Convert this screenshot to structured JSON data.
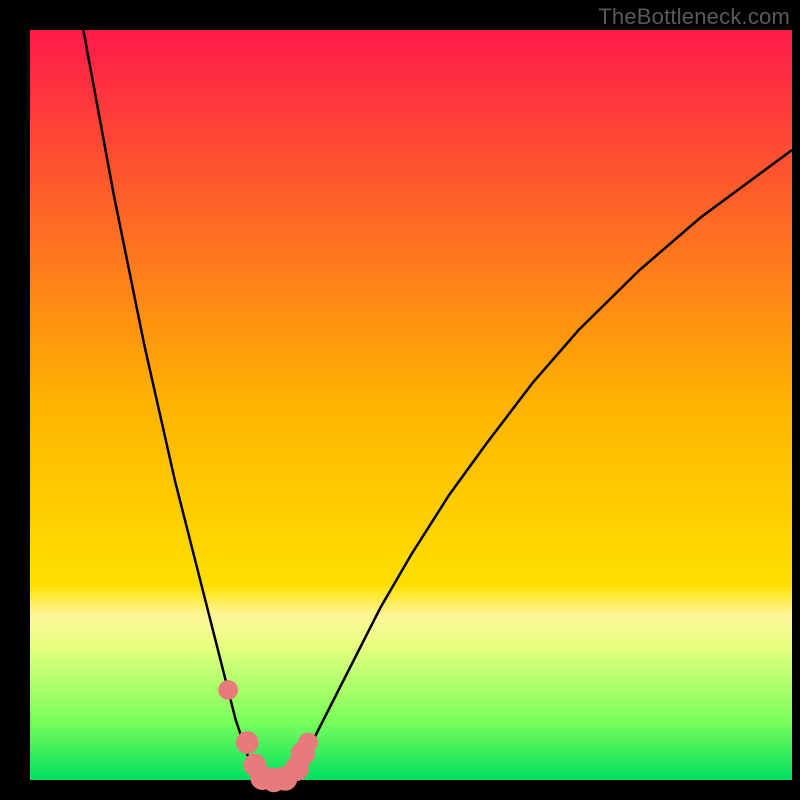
{
  "watermark": "TheBottleneck.com",
  "chart_data": {
    "type": "line",
    "title": "",
    "xlabel": "",
    "ylabel": "",
    "xlim": [
      0,
      100
    ],
    "ylim": [
      0,
      100
    ],
    "background_gradient": {
      "stops": [
        {
          "offset": 0,
          "color": "#ff1a4a"
        },
        {
          "offset": 50,
          "color": "#ffb400"
        },
        {
          "offset": 74,
          "color": "#ffe000"
        },
        {
          "offset": 78,
          "color": "#fff79a"
        },
        {
          "offset": 82,
          "color": "#e8ff80"
        },
        {
          "offset": 92,
          "color": "#7cff5a"
        },
        {
          "offset": 100,
          "color": "#00e060"
        }
      ]
    },
    "series": [
      {
        "name": "left-curve",
        "x": [
          7,
          9,
          11,
          13,
          15,
          17,
          19,
          21,
          23,
          25,
          26,
          27,
          28,
          29,
          30
        ],
        "y": [
          100,
          89,
          78,
          68,
          58,
          49,
          40,
          32,
          24,
          16,
          12,
          8,
          5,
          2,
          0
        ]
      },
      {
        "name": "right-curve",
        "x": [
          34,
          36,
          38,
          40,
          43,
          46,
          50,
          55,
          60,
          66,
          72,
          80,
          88,
          96,
          100
        ],
        "y": [
          0,
          3,
          7,
          11,
          17,
          23,
          30,
          38,
          45,
          53,
          60,
          68,
          75,
          81,
          84
        ]
      },
      {
        "name": "flat-bottom",
        "x": [
          30,
          34
        ],
        "y": [
          0,
          0
        ]
      }
    ],
    "markers": [
      {
        "x": 26.0,
        "y": 12.0,
        "r": 1.3
      },
      {
        "x": 28.5,
        "y": 5.0,
        "r": 1.5
      },
      {
        "x": 29.5,
        "y": 2.0,
        "r": 1.5
      },
      {
        "x": 30.5,
        "y": 0.3,
        "r": 1.6
      },
      {
        "x": 32.0,
        "y": 0.0,
        "r": 1.6
      },
      {
        "x": 33.5,
        "y": 0.2,
        "r": 1.6
      },
      {
        "x": 35.0,
        "y": 1.5,
        "r": 1.6
      },
      {
        "x": 35.8,
        "y": 3.5,
        "r": 1.6
      },
      {
        "x": 36.5,
        "y": 5.0,
        "r": 1.3
      }
    ],
    "marker_color": "#e77b7b",
    "curve_color": "#000000"
  }
}
